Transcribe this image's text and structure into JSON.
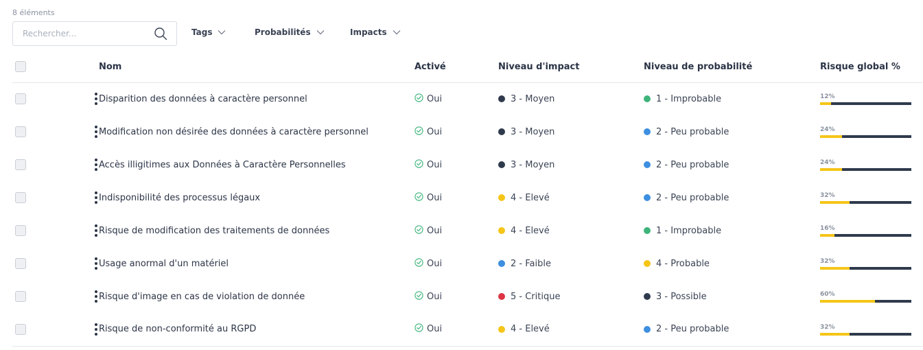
{
  "toolbar": {
    "count_label": "8 éléments",
    "search_placeholder": "Rechercher...",
    "filters": [
      "Tags",
      "Probabilités",
      "Impacts"
    ]
  },
  "columns": {
    "name": "Nom",
    "active": "Activé",
    "impact": "Niveau d'impact",
    "probability": "Niveau de probabilité",
    "risk": "Risque global %"
  },
  "colors": {
    "accent_yellow": "#f5c518",
    "dark_navy": "#2f3a4c",
    "green": "#3eb47a",
    "blue": "#3d8fe0",
    "red": "#dc3545",
    "check_green": "#3eb47a"
  },
  "rows": [
    {
      "name": "Disparition des données à caractère personnel",
      "active": "Oui",
      "impact": {
        "label": "3 - Moyen",
        "color": "#2f3a4c"
      },
      "probability": {
        "label": "1 - Improbable",
        "color": "#3eb47a"
      },
      "risk_percent": 12,
      "risk_label": "12%"
    },
    {
      "name": "Modification non désirée des données à caractère personnel",
      "active": "Oui",
      "impact": {
        "label": "3 - Moyen",
        "color": "#2f3a4c"
      },
      "probability": {
        "label": "2 - Peu probable",
        "color": "#3d8fe0"
      },
      "risk_percent": 24,
      "risk_label": "24%"
    },
    {
      "name": "Accès illigitimes aux Données à Caractère Personnelles",
      "active": "Oui",
      "impact": {
        "label": "3 - Moyen",
        "color": "#2f3a4c"
      },
      "probability": {
        "label": "2 - Peu probable",
        "color": "#3d8fe0"
      },
      "risk_percent": 24,
      "risk_label": "24%"
    },
    {
      "name": "Indisponibilité des processus légaux",
      "active": "Oui",
      "impact": {
        "label": "4 - Elevé",
        "color": "#f5c518"
      },
      "probability": {
        "label": "2 - Peu probable",
        "color": "#3d8fe0"
      },
      "risk_percent": 32,
      "risk_label": "32%"
    },
    {
      "name": "Risque de modification des traitements de données",
      "active": "Oui",
      "impact": {
        "label": "4 - Elevé",
        "color": "#f5c518"
      },
      "probability": {
        "label": "1 - Improbable",
        "color": "#3eb47a"
      },
      "risk_percent": 16,
      "risk_label": "16%"
    },
    {
      "name": "Usage anormal d'un matériel",
      "active": "Oui",
      "impact": {
        "label": "2 - Faible",
        "color": "#3d8fe0"
      },
      "probability": {
        "label": "4 - Probable",
        "color": "#f5c518"
      },
      "risk_percent": 32,
      "risk_label": "32%"
    },
    {
      "name": "Risque d'image en cas de violation de donnée",
      "active": "Oui",
      "impact": {
        "label": "5 - Critique",
        "color": "#dc3545"
      },
      "probability": {
        "label": "3 - Possible",
        "color": "#2f3a4c"
      },
      "risk_percent": 60,
      "risk_label": "60%"
    },
    {
      "name": "Risque de non-conformité au RGPD",
      "active": "Oui",
      "impact": {
        "label": "4 - Elevé",
        "color": "#f5c518"
      },
      "probability": {
        "label": "2 - Peu probable",
        "color": "#3d8fe0"
      },
      "risk_percent": 32,
      "risk_label": "32%"
    }
  ]
}
